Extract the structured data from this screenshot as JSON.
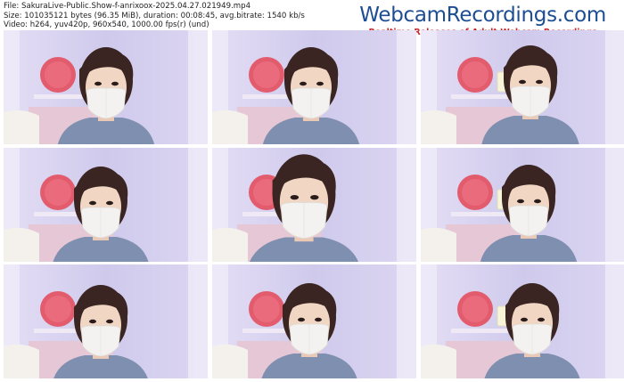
{
  "file_info": {
    "file_line": "File: SakuraLive-Public.Show-f-anrixoox-2025.04.27.021949.mp4",
    "size_line": "Size: 101035121 bytes (96.35 MiB), duration: 00:08:45, avg.bitrate: 1540 kb/s",
    "video_line": "Video: h264, yuv420p, 960x540, 1000.00 fps(r) (und)"
  },
  "brand": {
    "title": "WebcamRecordings.com",
    "subtitle": "Realtime Releases of Adult Webcam Recordings"
  },
  "colors": {
    "brand_blue": "#1d4e93",
    "brand_red": "#c8282e",
    "frame_background": "#d8d4ef",
    "clock": "#e35c6e",
    "mask": "#f3f2f0",
    "hair": "#3a2522",
    "sweater": "#7f8fb0"
  },
  "thumbnails": [
    {
      "frame": 1,
      "subject": "woman-with-face-mask"
    },
    {
      "frame": 2,
      "subject": "woman-with-face-mask"
    },
    {
      "frame": 3,
      "subject": "woman-with-face-mask"
    },
    {
      "frame": 4,
      "subject": "woman-with-face-mask"
    },
    {
      "frame": 5,
      "subject": "woman-with-face-mask"
    },
    {
      "frame": 6,
      "subject": "woman-with-face-mask"
    },
    {
      "frame": 7,
      "subject": "woman-with-face-mask"
    },
    {
      "frame": 8,
      "subject": "woman-with-face-mask"
    },
    {
      "frame": 9,
      "subject": "woman-with-face-mask"
    }
  ]
}
